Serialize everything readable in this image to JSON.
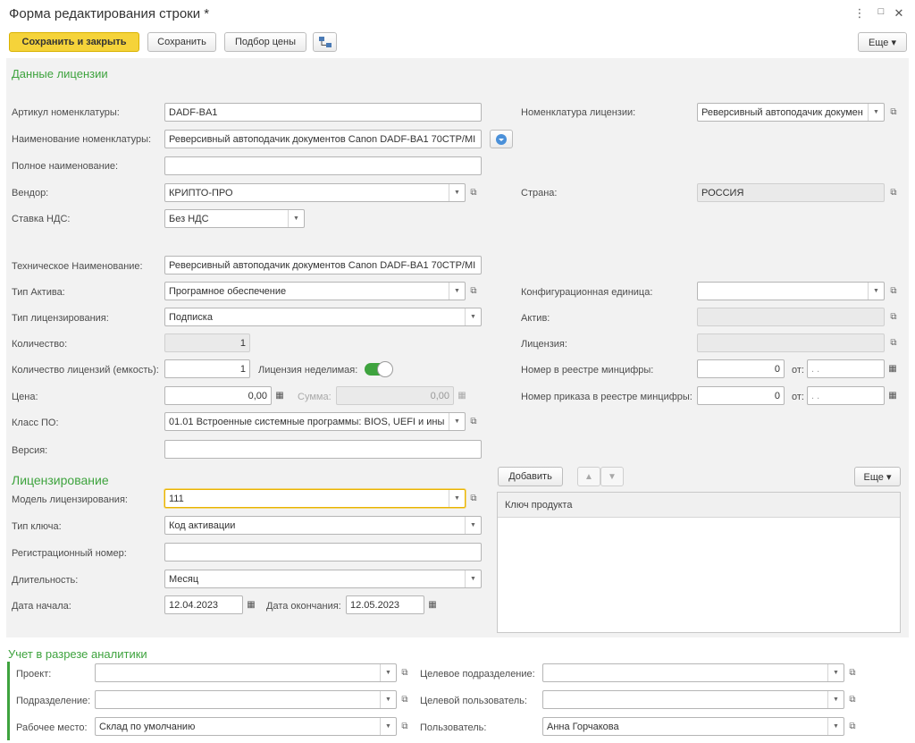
{
  "window": {
    "title": "Форма редактирования строки *",
    "more_icon": "⋮",
    "max_icon": "□",
    "close_icon": "✕"
  },
  "toolbar": {
    "save_close": "Сохранить и закрыть",
    "save": "Сохранить",
    "price": "Подбор цены",
    "more": "Еще ▾"
  },
  "license_data": {
    "title": "Данные лицензии",
    "article_label": "Артикул номенклатуры:",
    "article": "DADF-BA1",
    "name_label": "Наименование номенклатуры:",
    "name": "Реверсивный автоподачик документов Canon DADF-BA1 70CTP/MI",
    "full_name_label": "Полное  наименование:",
    "full_name": "",
    "vendor_label": "Вендор:",
    "vendor": "КРИПТО-ПРО",
    "vat_label": "Ставка НДС:",
    "vat": "Без НДС",
    "tech_name_label": "Техническое Наименование:",
    "tech_name": "Реверсивный автоподачик документов Canon DADF-BA1 70CTP/MI",
    "asset_type_label": "Тип Актива:",
    "asset_type": "Програмное обеспечение",
    "lic_type_label": "Тип лицензирования:",
    "lic_type": "Подписка",
    "qty_label": "Количество:",
    "qty": "1",
    "lic_qty_label": "Количество лицензий (емкость):",
    "lic_qty": "1",
    "indivisible_label": "Лицензия неделимая:",
    "price_label": "Цена:",
    "price": "0,00",
    "sum_label": "Сумма:",
    "sum": "0,00",
    "class_label": "Класс ПО:",
    "class": "01.01 Встроенные системные программы: BIOS, UEFI и ины",
    "version_label": "Версия:",
    "version": "",
    "nom_lic_label": "Номенклатура лицензии:",
    "nom_lic": "Реверсивный автоподачик докумен",
    "country_label": "Страна:",
    "country": "РОССИЯ",
    "config_label": "Конфигурационная единица:",
    "config": "",
    "active_label": "Актив:",
    "active": "",
    "license_label": "Лицензия:",
    "license": "",
    "registry_label": "Номер в реестре минцифры:",
    "registry": "0",
    "order_label": "Номер приказа в реестре минцифры:",
    "order": "0",
    "from_label": "от:",
    "date_placeholder": " .  ."
  },
  "licensing": {
    "title": "Лицензирование",
    "model_label": "Модель лицензирования:",
    "model": "111",
    "key_type_label": "Тип ключа:",
    "key_type": "Код активации",
    "reg_label": "Регистрационный номер:",
    "reg": "",
    "duration_label": "Длительность:",
    "duration": "Месяц",
    "start_label": "Дата начала:",
    "start": "12.04.2023",
    "end_label": "Дата окончания:",
    "end": "12.05.2023",
    "add_btn": "Добавить",
    "more_btn": "Еще ▾",
    "up_icon": "▲",
    "down_icon": "▼",
    "col_key": "Ключ продукта"
  },
  "analytics": {
    "title": "Учет в разрезе аналитики",
    "project_label": "Проект:",
    "project": "",
    "dept_label": "Подразделение:",
    "dept": "",
    "workplace_label": "Рабочее место:",
    "workplace": "Склад по умолчанию",
    "target_dept_label": "Целевое подразделение:",
    "target_dept": "",
    "target_user_label": "Целевой пользователь:",
    "target_user": "",
    "user_label": "Пользователь:",
    "user": "Анна Горчакова"
  }
}
